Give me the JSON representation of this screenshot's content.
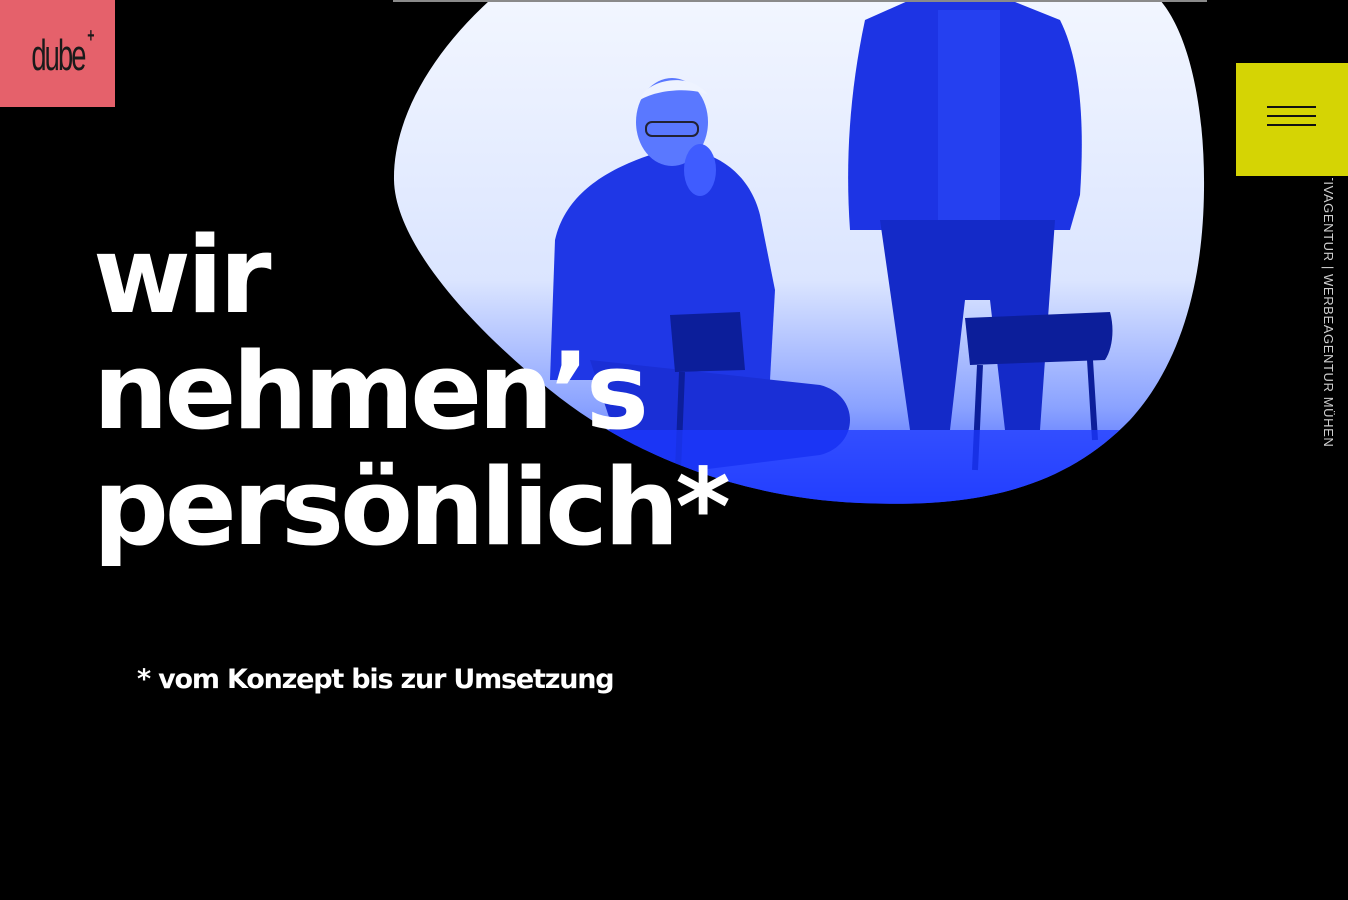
{
  "brand": {
    "logo_text": "dube",
    "logo_plus": "+",
    "logo_color": "#e5616b"
  },
  "menu": {
    "icon": "hamburger-icon",
    "color": "#d5d404"
  },
  "tagline_vertical": "KREATIVAGENTUR | WERBEAGENTUR MÜHEN",
  "hero": {
    "headline_lines": [
      "wir",
      "nehmen’s",
      "persönlich*"
    ],
    "subline": "* vom Konzept bis zur Umsetzung",
    "image_tint": "#1232e8"
  }
}
